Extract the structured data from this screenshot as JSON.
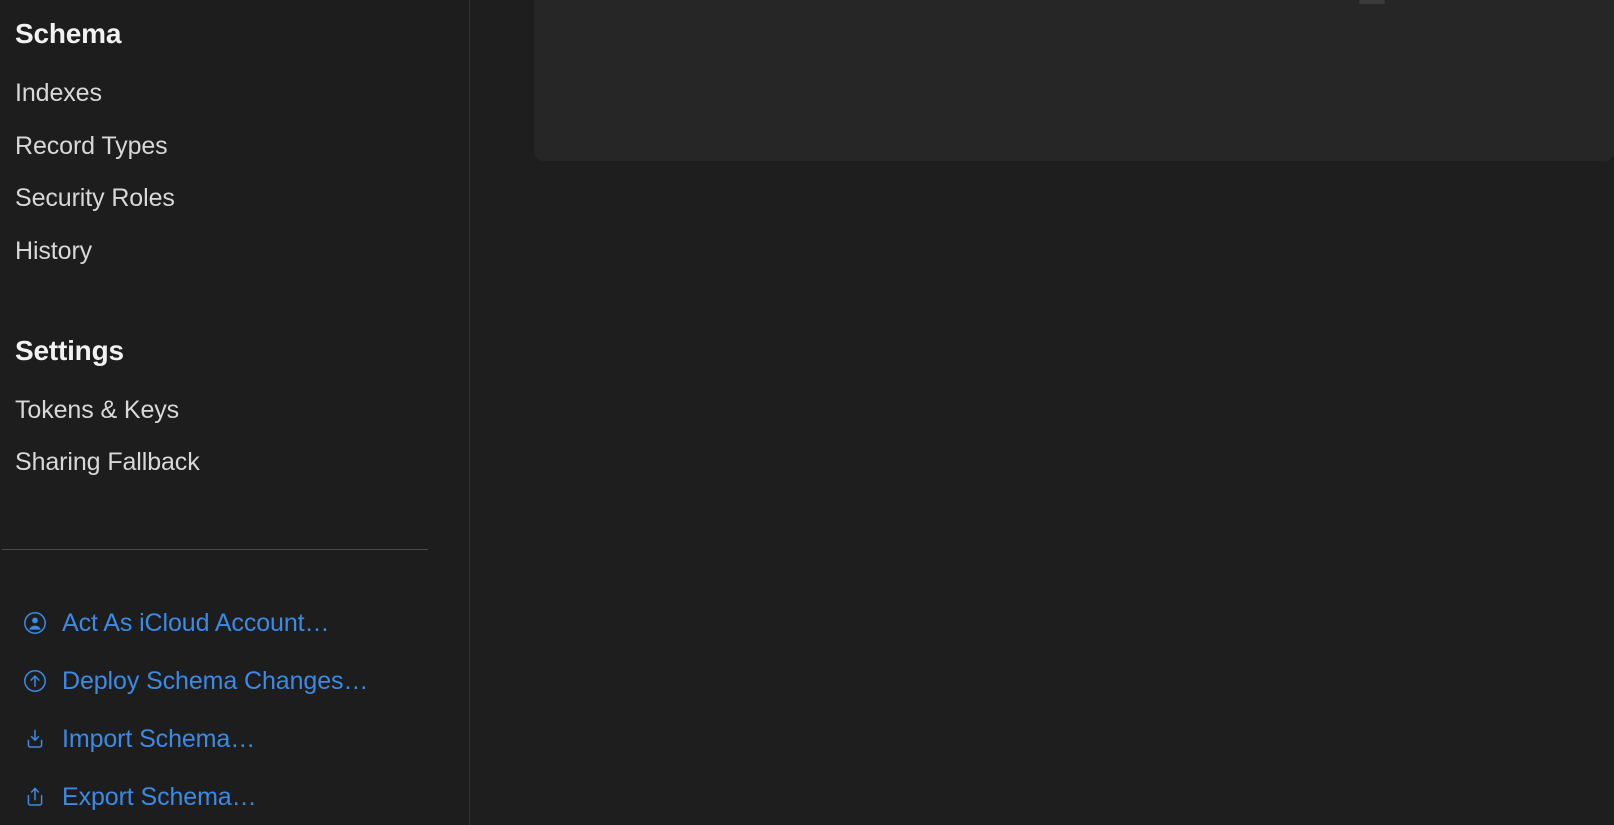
{
  "sidebar": {
    "sections": [
      {
        "header": "Schema",
        "items": [
          {
            "label": "Indexes"
          },
          {
            "label": "Record Types"
          },
          {
            "label": "Security Roles"
          },
          {
            "label": "History"
          }
        ]
      },
      {
        "header": "Settings",
        "items": [
          {
            "label": "Tokens & Keys"
          },
          {
            "label": "Sharing Fallback"
          }
        ]
      }
    ],
    "actions": [
      {
        "label": "Act As iCloud Account…",
        "icon": "person-circle-icon"
      },
      {
        "label": "Deploy Schema Changes…",
        "icon": "arrow-up-circle-icon"
      },
      {
        "label": "Import Schema…",
        "icon": "tray-and-arrow-down-icon"
      },
      {
        "label": "Export Schema…",
        "icon": "tray-and-arrow-up-icon"
      }
    ]
  },
  "colors": {
    "sidebar_background": "#1d1d1d",
    "main_background": "#1e1e1e",
    "card_background": "#262626",
    "accent_link": "#3b8ae6",
    "header_text": "#f2f2f2",
    "item_text": "#d8d8d8",
    "divider": "#4a4a4a"
  }
}
